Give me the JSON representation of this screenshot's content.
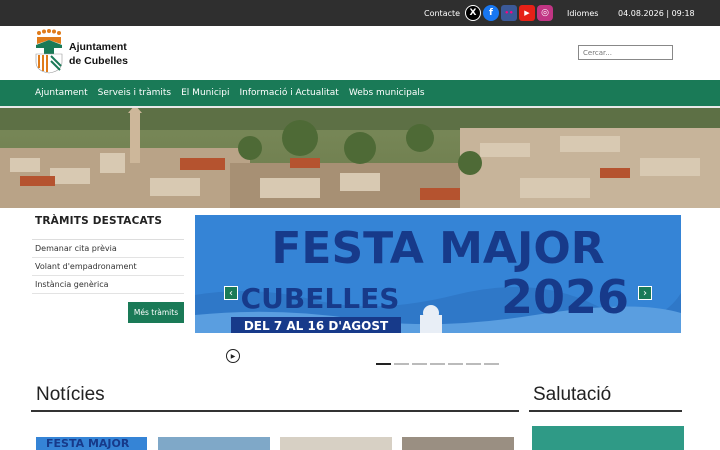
{
  "topbar": {
    "contact": "Contacte",
    "languages": "Idiomes",
    "datetime": "04.08.2026 | 09:18",
    "social": [
      {
        "icon": "x-twitter-icon",
        "glyph": "X"
      },
      {
        "icon": "facebook-icon",
        "glyph": "f"
      },
      {
        "icon": "flickr-icon",
        "glyph": "••"
      },
      {
        "icon": "youtube-icon",
        "glyph": "▶"
      },
      {
        "icon": "instagram-icon",
        "glyph": "◎"
      }
    ]
  },
  "header": {
    "logo_line1": "Ajuntament",
    "logo_line2": "de Cubelles",
    "search_placeholder": "Cercar..."
  },
  "nav": {
    "items": [
      "Ajuntament",
      "Serveis i tràmits",
      "El Municipi",
      "Informació i Actualitat",
      "Webs municipals"
    ]
  },
  "tramits": {
    "title": "TRÀMITS DESTACATS",
    "items": [
      "Demanar cita prèvia",
      "Volant d'empadronament",
      "Instància genèrica"
    ],
    "more": "Més tràmits"
  },
  "banner": {
    "line1": "FESTA MAJOR",
    "line2": "CUBELLES",
    "line3": "2026",
    "line4": "DEL 7 AL 16 D'AGOST",
    "prev": "‹",
    "next": "›",
    "play": "▶",
    "slide_count": 7,
    "active_slide": 1
  },
  "sections": {
    "news": "Notícies",
    "greeting": "Salutació"
  },
  "news_thumb_text": "FESTA MAJOR",
  "colors": {
    "brand_green": "#1a7a57",
    "topbar": "#2f2f2f",
    "banner_blue": "#2f7fd0"
  }
}
